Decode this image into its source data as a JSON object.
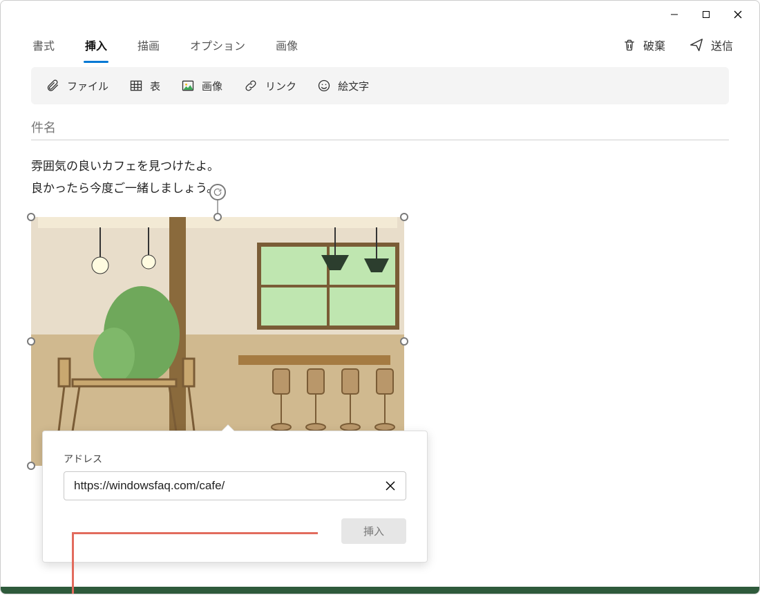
{
  "titlebar": {
    "minimize": "—",
    "maximize": "▢",
    "close": "✕"
  },
  "tabs": {
    "items": [
      {
        "label": "書式",
        "active": false
      },
      {
        "label": "挿入",
        "active": true
      },
      {
        "label": "描画",
        "active": false
      },
      {
        "label": "オプション",
        "active": false
      },
      {
        "label": "画像",
        "active": false
      }
    ]
  },
  "ribbonActions": {
    "discard": "破棄",
    "send": "送信"
  },
  "insertToolbar": {
    "file": "ファイル",
    "table": "表",
    "image": "画像",
    "link": "リンク",
    "emoji": "絵文字"
  },
  "subject": {
    "placeholder": "件名"
  },
  "body": {
    "line1": "雰囲気の良いカフェを見つけたよ。",
    "line2": "良かったら今度ご一緒しましょう。"
  },
  "image": {
    "alt": "cafe-interior"
  },
  "popup": {
    "label": "アドレス",
    "value": "https://windowsfaq.com/cafe/",
    "insert": "挿入"
  }
}
